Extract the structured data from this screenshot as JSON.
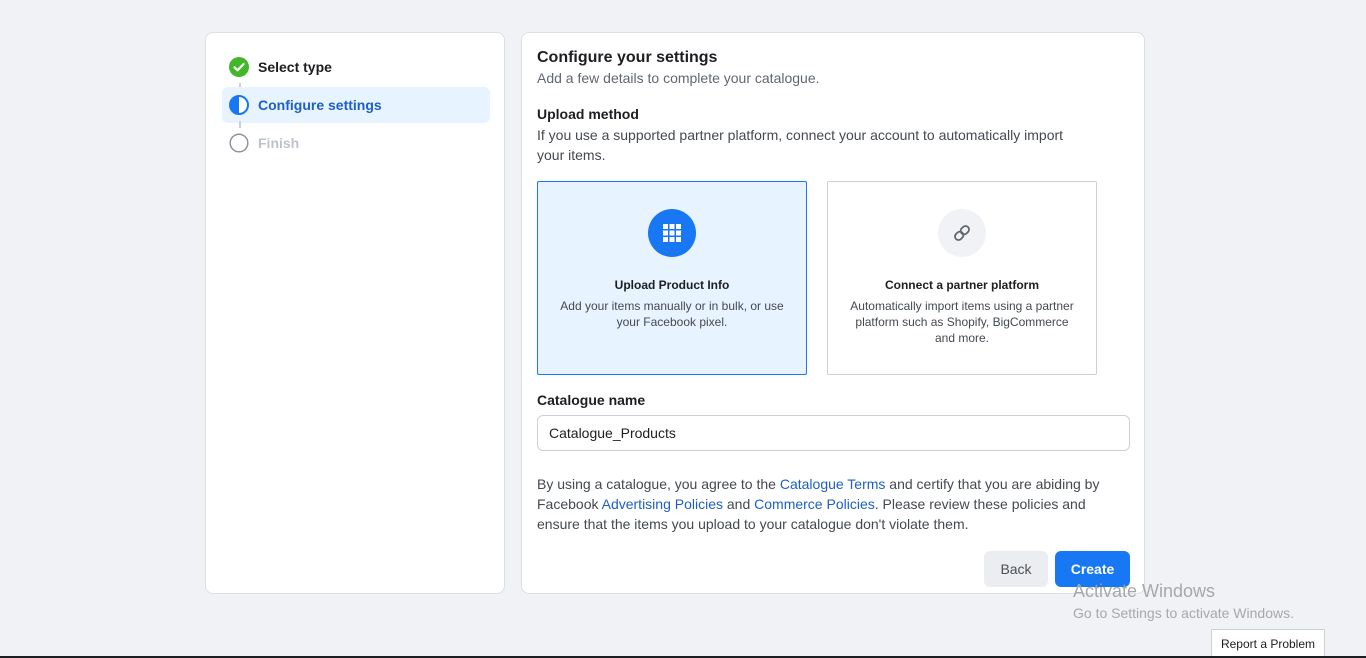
{
  "steps": [
    {
      "label": "Select type",
      "state": "complete",
      "icon": "check-circle-icon"
    },
    {
      "label": "Configure settings",
      "state": "current",
      "icon": "half-circle-icon"
    },
    {
      "label": "Finish",
      "state": "pending",
      "icon": "empty-circle-icon"
    }
  ],
  "header": {
    "title": "Configure your settings",
    "subtitle": "Add a few details to complete your catalogue."
  },
  "upload_method": {
    "label": "Upload method",
    "description": "If you use a supported partner platform, connect your account to automatically import your items.",
    "options": [
      {
        "title": "Upload Product Info",
        "description": "Add your items manually or in bulk, or use your Facebook pixel.",
        "icon": "grid-icon",
        "selected": true
      },
      {
        "title": "Connect a partner platform",
        "description": "Automatically import items using a partner platform such as Shopify, BigCommerce and more.",
        "icon": "link-icon",
        "selected": false
      }
    ]
  },
  "catalogue": {
    "label": "Catalogue name",
    "value": "Catalogue_Products"
  },
  "terms": {
    "part1": "By using a catalogue, you agree to the ",
    "link1": "Catalogue Terms",
    "part2": " and certify that you are abiding by Facebook ",
    "link2": "Advertising Policies",
    "part3": " and ",
    "link3": "Commerce Policies",
    "part4": ". Please review these policies and ensure that the items you upload to your catalogue don't violate them."
  },
  "buttons": {
    "back": "Back",
    "create": "Create"
  },
  "watermark": {
    "line1": "Activate Windows",
    "line2": "Go to Settings to activate Windows."
  },
  "report_problem": "Report a Problem",
  "colors": {
    "accent": "#1877f2",
    "success": "#42b72a",
    "selected_bg": "#e7f3ff"
  }
}
